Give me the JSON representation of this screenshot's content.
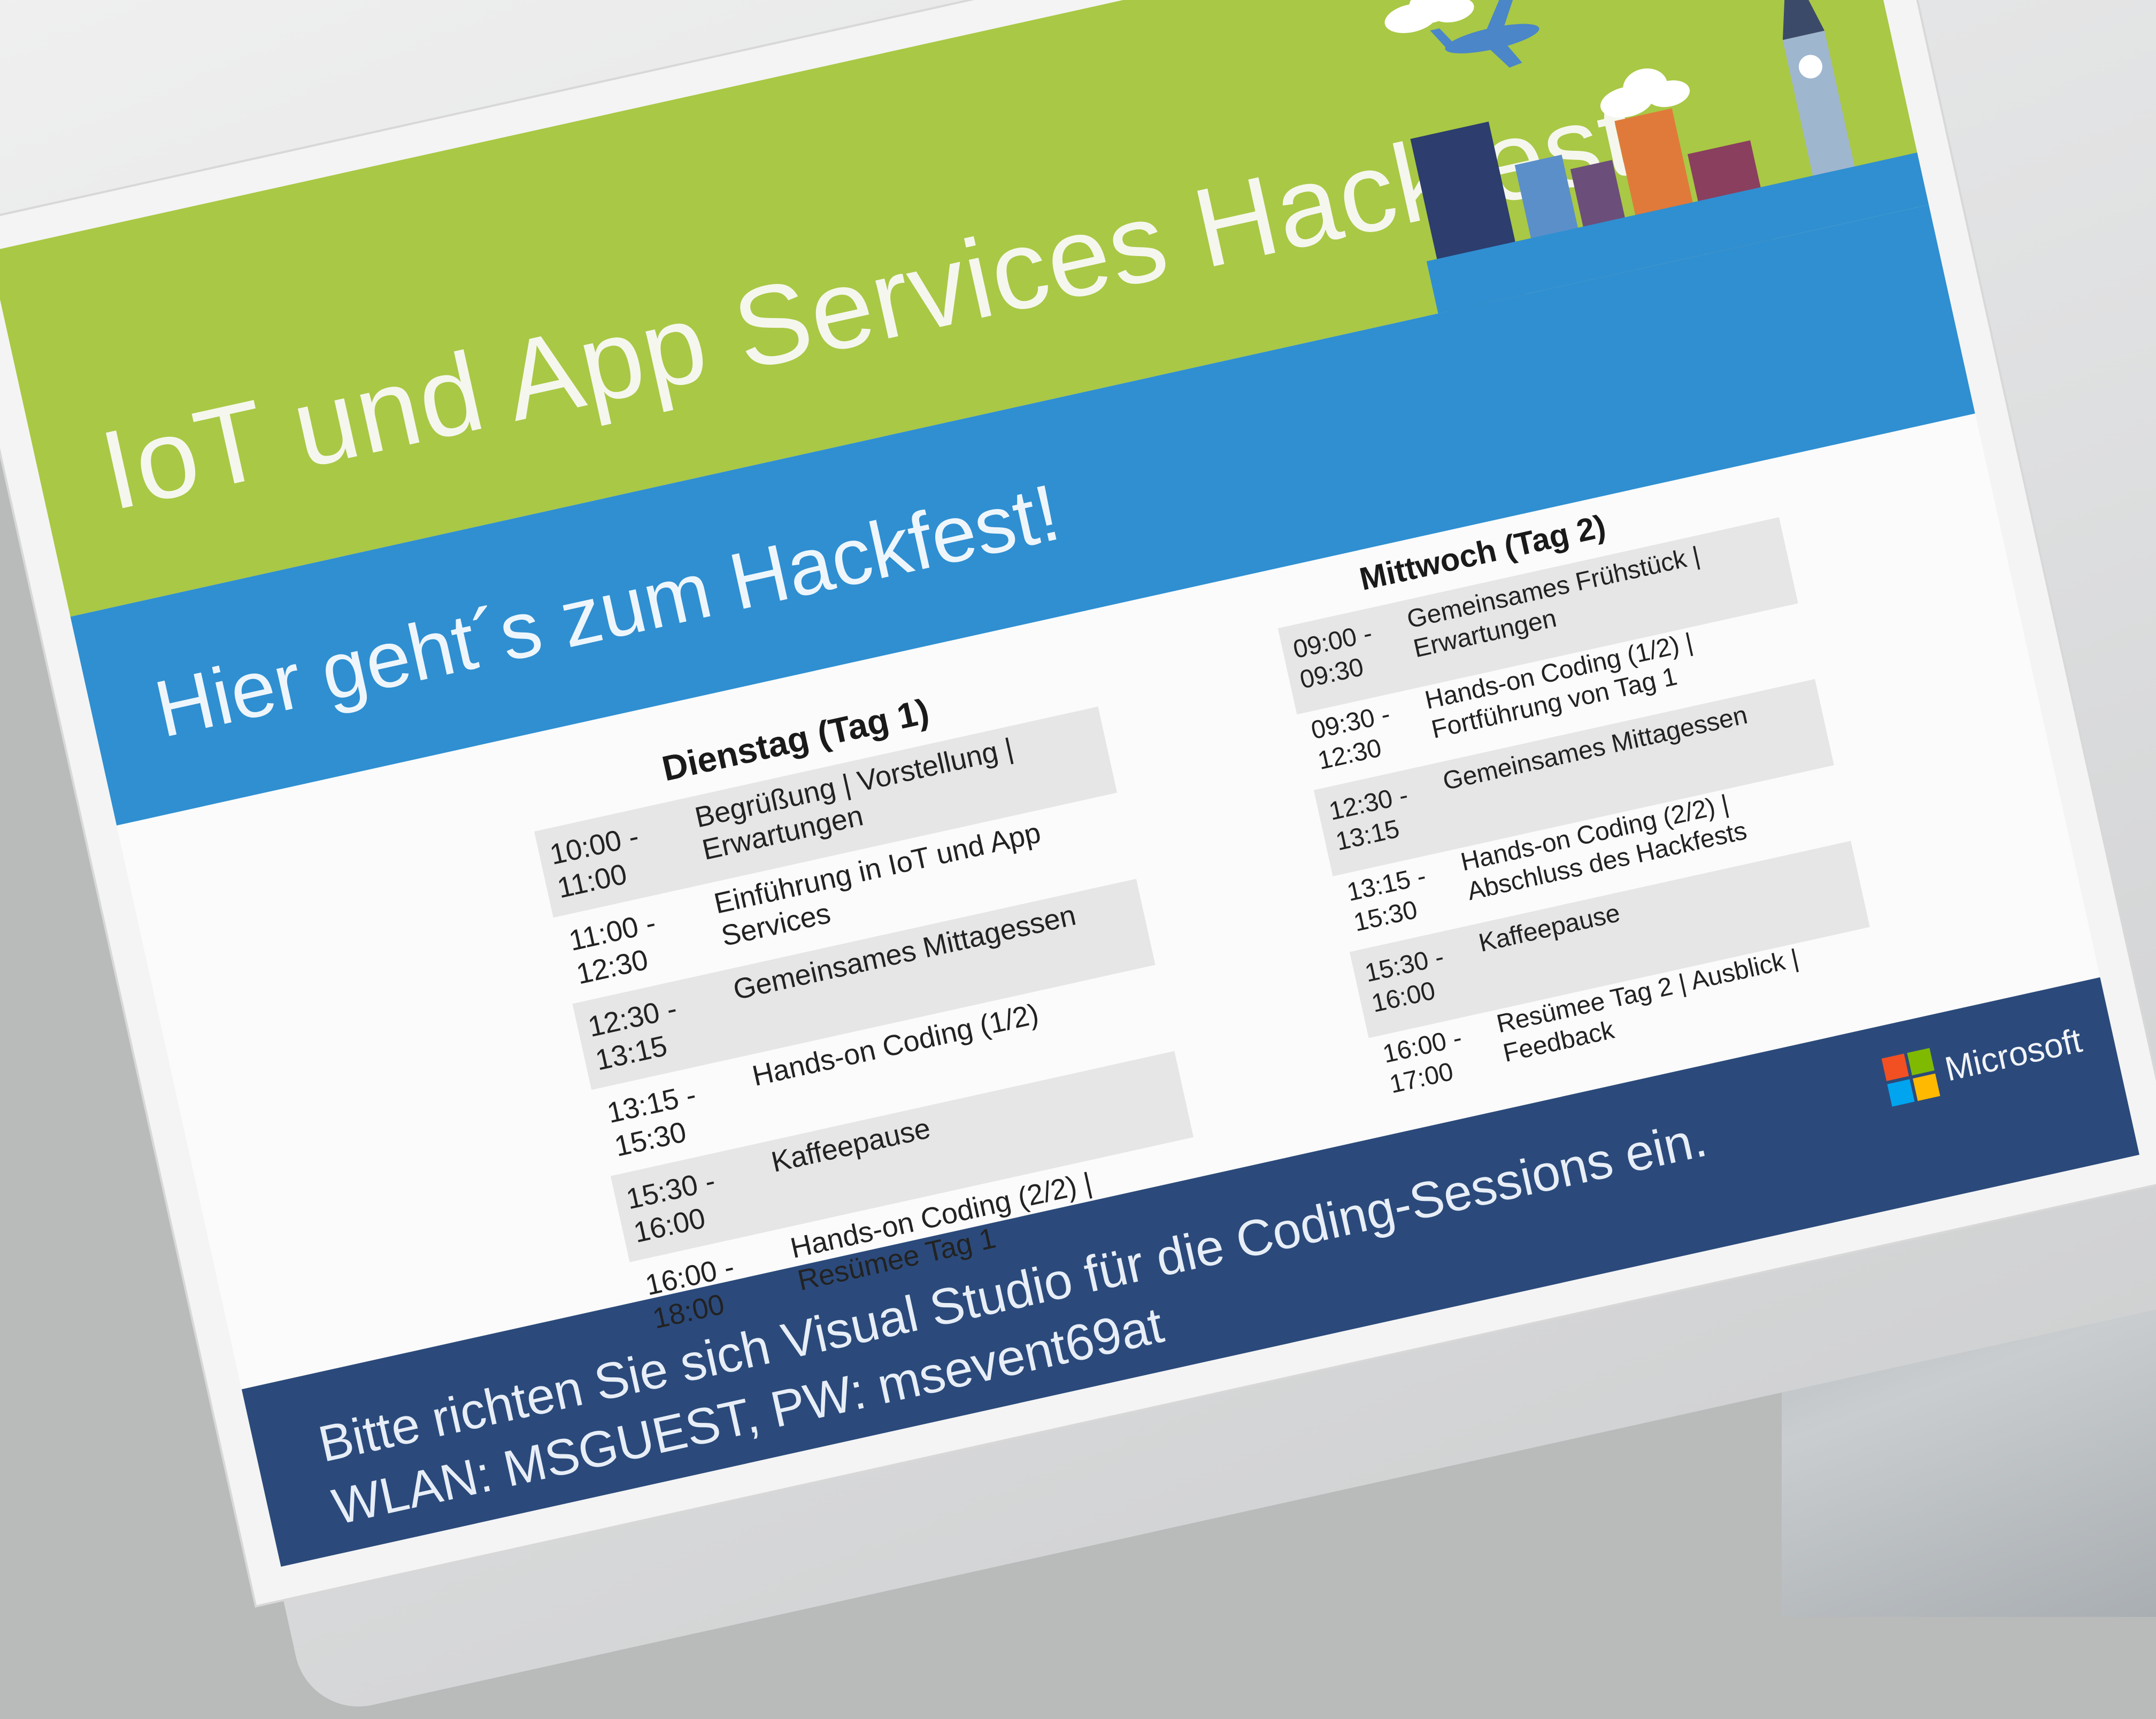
{
  "poster": {
    "title": "IoT und App Services Hackfest",
    "subtitle": "Hier geht´s zum Hackfest!",
    "brand": "Microsoft",
    "footer_line1": "Bitte richten Sie sich Visual Studio für die Coding-Sessions ein.",
    "footer_line2": "WLAN: MSGUEST, PW: msevent69at"
  },
  "day1": {
    "heading": "Dienstag (Tag 1)",
    "rows": [
      {
        "time": "10:00 -\n11:00",
        "text": "Begrüßung | Vorstellung | Erwartungen"
      },
      {
        "time": "11:00 -\n12:30",
        "text": "Einführung in IoT und App Services"
      },
      {
        "time": "12:30 -\n13:15",
        "text": "Gemeinsames Mittagessen"
      },
      {
        "time": "13:15 -\n15:30",
        "text": "Hands-on Coding (1/2)"
      },
      {
        "time": "15:30 -\n16:00",
        "text": "Kaffeepause"
      },
      {
        "time": "16:00 -\n18:00",
        "text": "Hands-on Coding (2/2) | Resümee Tag 1"
      }
    ]
  },
  "day2": {
    "heading": "Mittwoch (Tag 2)",
    "rows": [
      {
        "time": "09:00 -\n09:30",
        "text": "Gemeinsames Frühstück | Erwartungen"
      },
      {
        "time": "09:30 -\n12:30",
        "text": "Hands-on Coding (1/2) | Fortführung von Tag 1"
      },
      {
        "time": "12:30 -\n13:15",
        "text": "Gemeinsames Mittagessen"
      },
      {
        "time": "13:15 -\n15:30",
        "text": "Hands-on Coding (2/2) | Abschluss des Hackfests"
      },
      {
        "time": "15:30 -\n16:00",
        "text": "Kaffeepause"
      },
      {
        "time": "16:00 -\n17:00",
        "text": "Resümee Tag 2 | Ausblick | Feedback"
      }
    ]
  },
  "colors": {
    "green": "#a9c845",
    "blue": "#2f8fd1",
    "navy": "#2b4a7b",
    "row_shade": "#e6e6e6"
  }
}
